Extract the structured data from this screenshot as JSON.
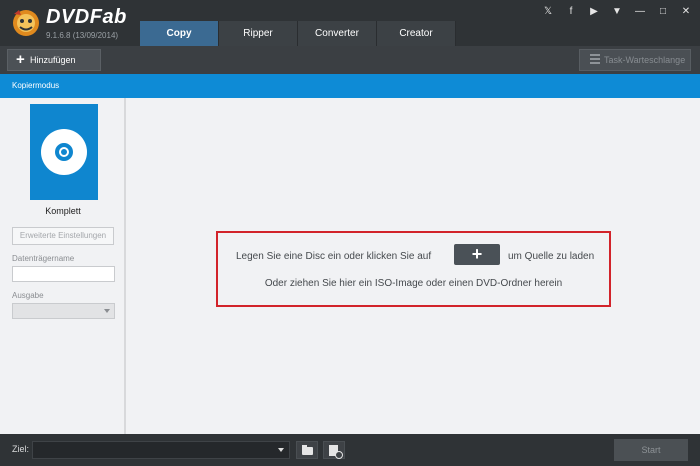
{
  "app": {
    "brand": "DVDFab",
    "version": "9.1.6.8 (13/09/2014)"
  },
  "tabs": [
    {
      "label": "Copy",
      "active": true
    },
    {
      "label": "Ripper",
      "active": false
    },
    {
      "label": "Converter",
      "active": false
    },
    {
      "label": "Creator",
      "active": false
    }
  ],
  "window_controls": [
    "twitter-icon",
    "facebook-icon",
    "youtube-icon",
    "dropdown-icon",
    "minimize-icon",
    "maximize-icon",
    "close-icon"
  ],
  "toolbar": {
    "add_label": "Hinzufügen",
    "queue_label": "Task-Warteschlange"
  },
  "bluebar": {
    "mode_label": "Kopiermodus"
  },
  "left_panel": {
    "mode_name": "Komplett",
    "advanced_button": "Erweiterte Einstellungen",
    "volume_label": "Datenträgername",
    "volume_value": "",
    "output_label": "Ausgabe",
    "output_value": ""
  },
  "main": {
    "line1_before": "Legen Sie eine Disc ein oder klicken Sie auf",
    "plus_symbol": "+",
    "line1_after": "um Quelle zu laden",
    "line2": "Oder ziehen Sie hier ein ISO-Image oder einen DVD-Ordner herein"
  },
  "bottom": {
    "target_label": "Ziel:",
    "target_value": "",
    "start_label": "Start"
  },
  "colors": {
    "accent_blue": "#0e8bd6",
    "highlight_red": "#d2232a",
    "dark_bg": "#2f3336"
  }
}
